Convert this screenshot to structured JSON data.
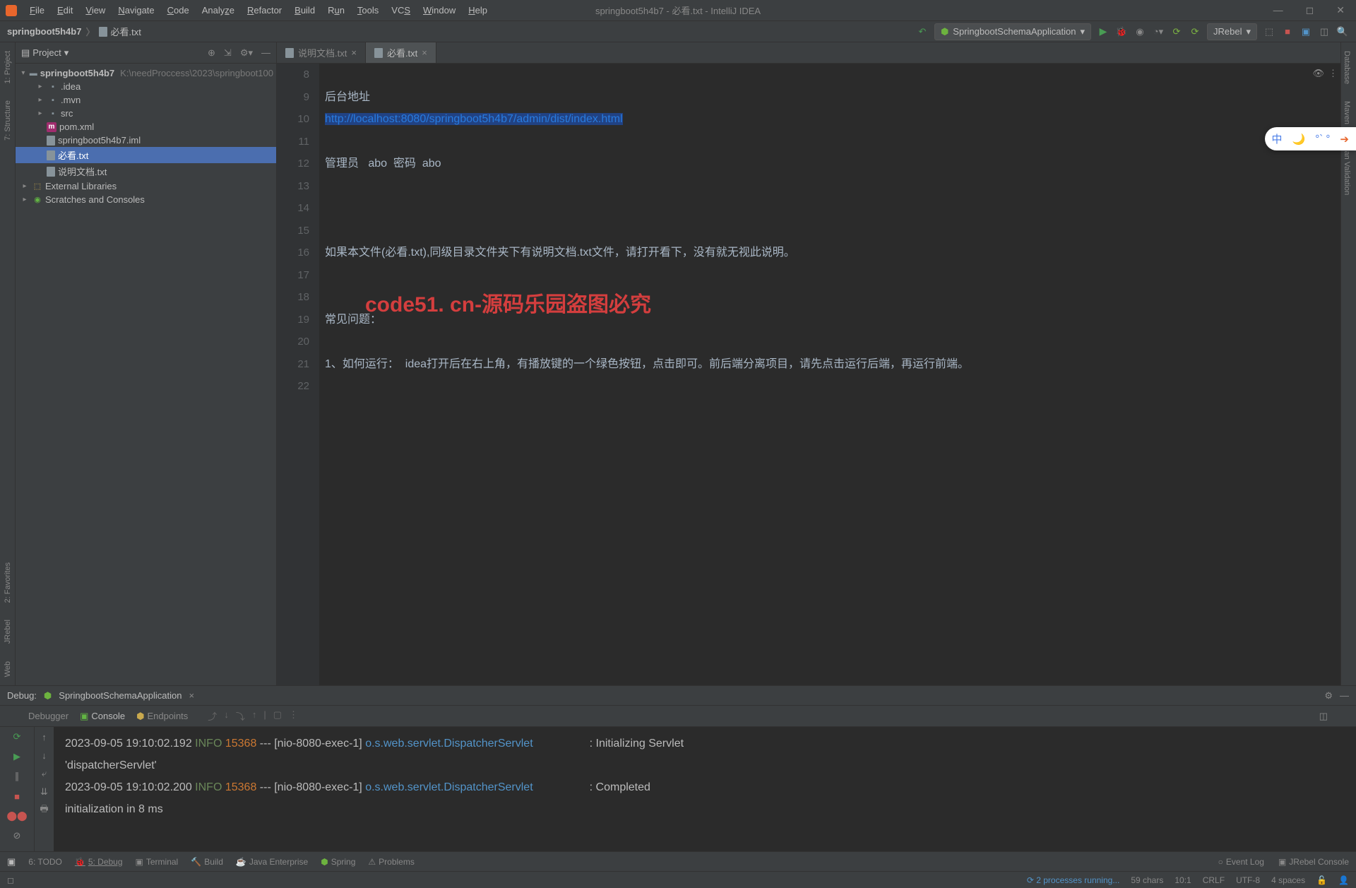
{
  "window": {
    "title": "springboot5h4b7 - 必看.txt - IntelliJ IDEA"
  },
  "menus": [
    "File",
    "Edit",
    "View",
    "Navigate",
    "Code",
    "Analyze",
    "Refactor",
    "Build",
    "Run",
    "Tools",
    "VCS",
    "Window",
    "Help"
  ],
  "breadcrumb": {
    "project": "springboot5h4b7",
    "file": "必看.txt"
  },
  "runConfig": {
    "name": "SpringbootSchemaApplication",
    "button": "JRebel"
  },
  "leftRail": [
    "1: Project",
    "7: Structure",
    "2: Favorites",
    "JRebel",
    "Web"
  ],
  "rightRail": [
    "Database",
    "Maven",
    "Bean Validation"
  ],
  "projectPanel": {
    "title": "Project",
    "root": {
      "name": "springboot5h4b7",
      "path": "K:\\needProccess\\2023\\springboot100"
    },
    "children": [
      {
        "name": ".idea",
        "type": "folder"
      },
      {
        "name": ".mvn",
        "type": "folder"
      },
      {
        "name": "src",
        "type": "folder"
      },
      {
        "name": "pom.xml",
        "type": "maven"
      },
      {
        "name": "springboot5h4b7.iml",
        "type": "file"
      },
      {
        "name": "必看.txt",
        "type": "file",
        "selected": true
      },
      {
        "name": "说明文档.txt",
        "type": "file"
      }
    ],
    "extLibs": "External Libraries",
    "scratches": "Scratches and Consoles"
  },
  "editorTabs": [
    {
      "name": "说明文档.txt",
      "active": false
    },
    {
      "name": "必看.txt",
      "active": true
    }
  ],
  "code": {
    "lines": [
      {
        "n": 8,
        "t": ""
      },
      {
        "n": 9,
        "t": "后台地址"
      },
      {
        "n": 10,
        "t": "http://localhost:8080/springboot5h4b7/admin/dist/index.html",
        "url": true
      },
      {
        "n": 11,
        "t": ""
      },
      {
        "n": 12,
        "t": "管理员   abo  密码  abo"
      },
      {
        "n": 13,
        "t": ""
      },
      {
        "n": 14,
        "t": ""
      },
      {
        "n": 15,
        "t": ""
      },
      {
        "n": 16,
        "t": "如果本文件(必看.txt),同级目录文件夹下有说明文档.txt文件，请打开看下，没有就无视此说明。"
      },
      {
        "n": 17,
        "t": ""
      },
      {
        "n": 18,
        "t": ""
      },
      {
        "n": 19,
        "t": "常见问题："
      },
      {
        "n": 20,
        "t": ""
      },
      {
        "n": 21,
        "t": "1、如何运行：  idea打开后在右上角，有播放键的一个绿色按钮，点击即可。前后端分离项目，请先点击运行后端，再运行前端。"
      },
      {
        "n": 22,
        "t": ""
      }
    ]
  },
  "watermarkCenter": "code51. cn-源码乐园盗图必究",
  "floatingWidget": [
    "中",
    "🌙",
    "°` °"
  ],
  "debug": {
    "title": "Debug:",
    "config": "SpringbootSchemaApplication",
    "tabs": [
      "Debugger",
      "Console",
      "Endpoints"
    ],
    "console": [
      {
        "time": "2023-09-05 19:10:02.192",
        "level": "INFO",
        "pid": "15368",
        "thread": "[nio-8080-exec-1]",
        "cls": "o.s.web.servlet.DispatcherServlet",
        "msg": ": Initializing Servlet"
      },
      {
        "cont": "'dispatcherServlet'"
      },
      {
        "time": "2023-09-05 19:10:02.200",
        "level": "INFO",
        "pid": "15368",
        "thread": "[nio-8080-exec-1]",
        "cls": "o.s.web.servlet.DispatcherServlet",
        "msg": ": Completed"
      },
      {
        "cont": "initialization in 8 ms"
      }
    ]
  },
  "bottomTabs": [
    "6: TODO",
    "5: Debug",
    "Terminal",
    "Build",
    "Java Enterprise",
    "Spring",
    "Problems"
  ],
  "bottomRight": [
    "Event Log",
    "JRebel Console"
  ],
  "status": {
    "processes": "2 processes running...",
    "chars": "59 chars",
    "pos": "10:1",
    "le": "CRLF",
    "enc": "UTF-8",
    "indent": "4 spaces"
  }
}
